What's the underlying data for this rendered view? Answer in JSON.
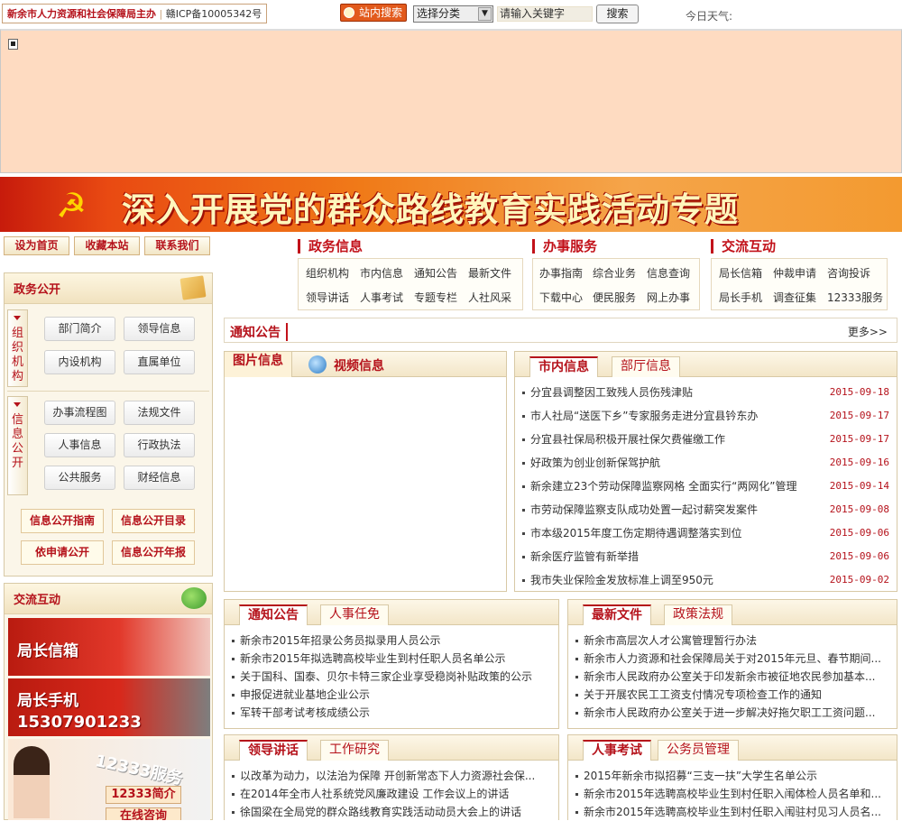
{
  "topbar": {
    "site_name": "新余市人力资源和社会保障局主办",
    "icp": "赣ICP备10005342号",
    "search_tag": "站内搜索",
    "category_select": "选择分类",
    "keyword_placeholder": "请输入关键字",
    "search_button": "搜索",
    "weather": "今日天气:"
  },
  "banner": {
    "title": "深入开展党的群众路线教育实践活动专题",
    "emblem": "☭"
  },
  "quick_links": [
    "设为首页",
    "收藏本站",
    "联系我们"
  ],
  "nav": [
    {
      "title": "政务信息",
      "links": [
        "组织机构",
        "市内信息",
        "通知公告",
        "最新文件",
        "领导讲话",
        "人事考试",
        "专题专栏",
        "人社风采"
      ]
    },
    {
      "title": "办事服务",
      "links": [
        "办事指南",
        "综合业务",
        "信息查询",
        "下载中心",
        "便民服务",
        "网上办事"
      ]
    },
    {
      "title": "交流互动",
      "links": [
        "局长信箱",
        "仲裁申请",
        "咨询投诉",
        "局长手机",
        "调查征集",
        "12333服务"
      ]
    }
  ],
  "gov_open": {
    "title": "政务公开",
    "org_tab": "组织机构",
    "org_buttons": [
      "部门简介",
      "领导信息",
      "内设机构",
      "直属单位"
    ],
    "info_tab": "信息公开",
    "info_buttons": [
      "办事流程图",
      "法规文件",
      "人事信息",
      "行政执法",
      "公共服务",
      "财经信息"
    ],
    "orange_buttons": [
      "信息公开指南",
      "信息公开目录",
      "依申请公开",
      "信息公开年报"
    ]
  },
  "interact": {
    "title": "交流互动",
    "mailbox": "局长信箱",
    "phone_label": "局长手机",
    "phone_number": "15307901233",
    "service_title": "12333服务",
    "service_intro": "12333简介",
    "service_online": "在线咨询"
  },
  "notice_bar": {
    "title": "通知公告",
    "more": "更多>>"
  },
  "media": {
    "tab_pictures": "图片信息",
    "tab_video": "视频信息"
  },
  "city_news": {
    "tab_active": "市内信息",
    "tab_other": "部厅信息",
    "items": [
      {
        "title": "分宜县调整因工致残人员伤残津贴",
        "date": "2015-09-18"
      },
      {
        "title": "市人社局“送医下乡”专家服务走进分宜县钤东办",
        "date": "2015-09-17"
      },
      {
        "title": "分宜县社保局积极开展社保欠费催缴工作",
        "date": "2015-09-17"
      },
      {
        "title": "好政策为创业创新保驾护航",
        "date": "2015-09-16"
      },
      {
        "title": "新余建立23个劳动保障监察网格 全面实行“两网化”管理",
        "date": "2015-09-14"
      },
      {
        "title": "市劳动保障监察支队成功处置一起讨薪突发案件",
        "date": "2015-09-08"
      },
      {
        "title": "市本级2015年度工伤定期待遇调整落实到位",
        "date": "2015-09-06"
      },
      {
        "title": "新余医疗监管有新举措",
        "date": "2015-09-06"
      },
      {
        "title": "我市失业保险金发放标准上调至950元",
        "date": "2015-09-02"
      }
    ]
  },
  "notice_panel": {
    "tab_active": "通知公告",
    "tab_other": "人事任免",
    "items": [
      "新余市2015年招录公务员拟录用人员公示",
      "新余市2015年拟选聘高校毕业生到村任职人员名单公示",
      "关于国科、国泰、贝尔卡特三家企业享受稳岗补贴政策的公示",
      "申报促进就业基地企业公示",
      "军转干部考试考核成绩公示"
    ]
  },
  "docs_panel": {
    "tab_active": "最新文件",
    "tab_other": "政策法规",
    "items": [
      "新余市高层次人才公寓管理暂行办法",
      "新余市人力资源和社会保障局关于对2015年元旦、春节期间...",
      "新余市人民政府办公室关于印发新余市被征地农民参加基本...",
      "关于开展农民工工资支付情况专项检查工作的通知",
      "新余市人民政府办公室关于进一步解决好拖欠职工工资问题..."
    ]
  },
  "speech_panel": {
    "tab_active": "领导讲话",
    "tab_other": "工作研究",
    "items": [
      "以改革为动力，以法治为保障 开创新常态下人力资源社会保...",
      "在2014年全市人社系统党风廉政建设 工作会议上的讲话",
      "徐国梁在全局党的群众路线教育实践活动动员大会上的讲话"
    ]
  },
  "exam_panel": {
    "tab_active": "人事考试",
    "tab_other": "公务员管理",
    "items": [
      "2015年新余市拟招募“三支一扶”大学生名单公示",
      "新余市2015年选聘高校毕业生到村任职入闱体检人员名单和...",
      "新余市2015年选聘高校毕业生到村任职入闱驻村见习人员名..."
    ]
  }
}
